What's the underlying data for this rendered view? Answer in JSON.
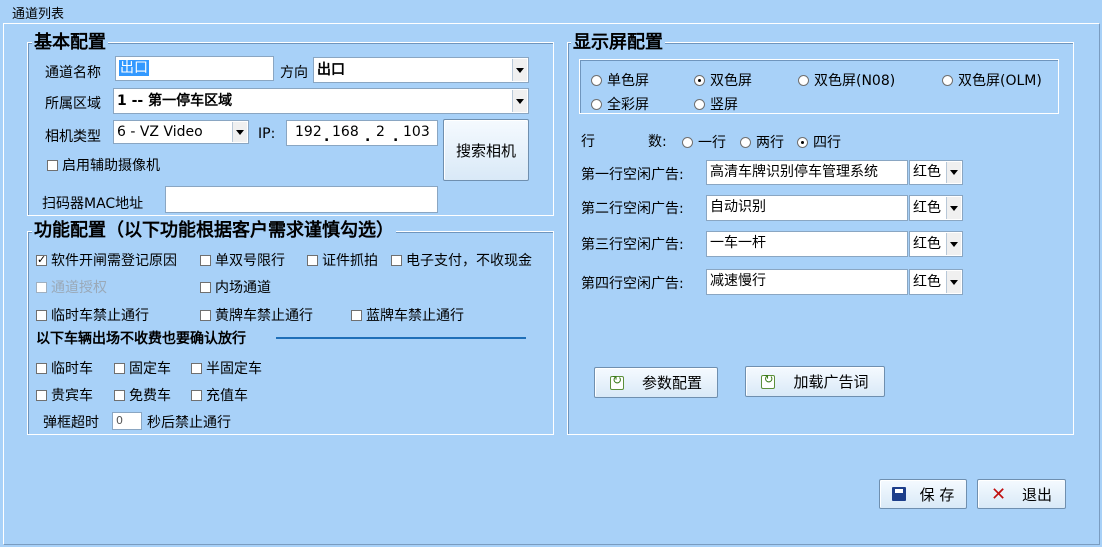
{
  "window": {
    "title": "通道列表"
  },
  "basic": {
    "legend": "基本配置",
    "channel_name_label": "通道名称",
    "channel_name_value": "出口",
    "direction_label": "方向",
    "direction_value": "出口",
    "area_label": "所属区域",
    "area_value": "1 -- 第一停车区域",
    "camera_type_label": "相机类型",
    "camera_type_value": "6 - VZ Video",
    "ip_label": "IP:",
    "ip": [
      "192",
      "168",
      "2",
      "103"
    ],
    "search_camera_button": "搜索相机",
    "aux_camera_label": "启用辅助摄像机",
    "scanner_mac_label": "扫码器MAC地址",
    "scanner_mac_value": ""
  },
  "func": {
    "legend": "功能配置（以下功能根据客户需求谨慎勾选）",
    "options": [
      {
        "label": "软件开闸需登记原因",
        "checked": true
      },
      {
        "label": "单双号限行",
        "checked": false
      },
      {
        "label": "证件抓拍",
        "checked": false
      },
      {
        "label": "电子支付，不收现金",
        "checked": false
      },
      {
        "label": "通道授权",
        "checked": false,
        "disabled": true
      },
      {
        "label": "内场通道",
        "checked": false
      },
      {
        "label": "临时车禁止通行",
        "checked": false
      },
      {
        "label": "黄牌车禁止通行",
        "checked": false
      },
      {
        "label": "蓝牌车禁止通行",
        "checked": false
      }
    ],
    "subheading": "以下车辆出场不收费也要确认放行",
    "vehicles": [
      {
        "label": "临时车"
      },
      {
        "label": "固定车"
      },
      {
        "label": "半固定车"
      },
      {
        "label": "贵宾车"
      },
      {
        "label": "免费车"
      },
      {
        "label": "充值车"
      }
    ],
    "timeout_prefix": "弹框超时",
    "timeout_value": "0",
    "timeout_suffix": "秒后禁止通行"
  },
  "display": {
    "legend": "显示屏配置",
    "screen_types": [
      {
        "label": "单色屏",
        "checked": false
      },
      {
        "label": "双色屏",
        "checked": true
      },
      {
        "label": "双色屏(N08)",
        "checked": false
      },
      {
        "label": "双色屏(OLM)",
        "checked": false
      },
      {
        "label": "全彩屏",
        "checked": false
      },
      {
        "label": "竖屏",
        "checked": false
      }
    ],
    "rows_label_1": "行",
    "rows_label_2": "数:",
    "rows": [
      {
        "label": "一行",
        "checked": false
      },
      {
        "label": "两行",
        "checked": false
      },
      {
        "label": "四行",
        "checked": true
      }
    ],
    "ads": [
      {
        "label": "第一行空闲广告:",
        "text": "高清车牌识别停车管理系统",
        "color": "红色"
      },
      {
        "label": "第二行空闲广告:",
        "text": "自动识别",
        "color": "红色"
      },
      {
        "label": "第三行空闲广告:",
        "text": "一车一杆",
        "color": "红色"
      },
      {
        "label": "第四行空闲广告:",
        "text": "减速慢行",
        "color": "红色"
      }
    ],
    "param_button": "参数配置",
    "load_ad_button": "加载广告词"
  },
  "footer": {
    "save": "保 存",
    "exit": "退出"
  }
}
